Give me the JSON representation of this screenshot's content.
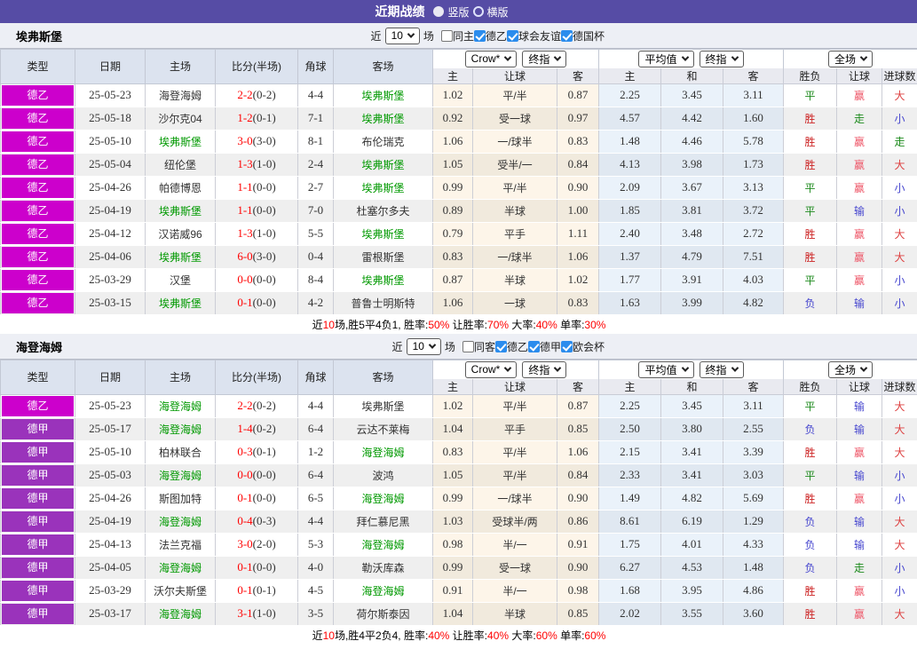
{
  "topbar": {
    "title": "近期战绩",
    "options": [
      {
        "label": "竖版",
        "selected": true
      },
      {
        "label": "横版",
        "selected": false
      }
    ]
  },
  "table_headers": {
    "left": [
      "类型",
      "日期",
      "主场",
      "比分(半场)",
      "角球",
      "客场"
    ],
    "asian": {
      "selects": [
        "Crow*",
        "终指"
      ],
      "cols": [
        "主",
        "让球",
        "客"
      ]
    },
    "euro": {
      "selects": [
        "平均值",
        "终指"
      ],
      "cols": [
        "主",
        "和",
        "客"
      ]
    },
    "result": {
      "selects": [
        "全场"
      ],
      "cols": [
        "胜负",
        "让球",
        "进球数"
      ]
    }
  },
  "filter": {
    "prefix": "近",
    "count": "10",
    "suffix": "场"
  },
  "league_colors": {
    "德乙": "#cc00cc",
    "德甲": "#9a33bb"
  },
  "result_colors": {
    "胜": "#cc2222",
    "平": "#1d8a1d",
    "负": "#4747cf",
    "赢": "#ee5567",
    "输": "#4747cf",
    "走": "#1d8a1d",
    "大": "#dd4040",
    "小": "#4747cf"
  },
  "teams": [
    {
      "name": "埃弗斯堡",
      "filters": [
        {
          "label": "同主",
          "checked": false
        },
        {
          "label": "德乙",
          "checked": true
        },
        {
          "label": "球会友谊",
          "checked": true
        },
        {
          "label": "德国杯",
          "checked": true
        }
      ],
      "rows": [
        {
          "lg": "德乙",
          "date": "25-05-23",
          "home": "海登海姆",
          "hs": false,
          "score": "2-2",
          "half": "(0-2)",
          "corner": "4-4",
          "away": "埃弗斯堡",
          "aws": true,
          "ah": [
            "1.02",
            "平/半",
            "0.87"
          ],
          "eu": [
            "2.25",
            "3.45",
            "3.11"
          ],
          "res": [
            "平",
            "赢",
            "大"
          ]
        },
        {
          "lg": "德乙",
          "date": "25-05-18",
          "home": "沙尔克04",
          "hs": false,
          "score": "1-2",
          "half": "(0-1)",
          "corner": "7-1",
          "away": "埃弗斯堡",
          "aws": true,
          "ah": [
            "0.92",
            "受一球",
            "0.97"
          ],
          "eu": [
            "4.57",
            "4.42",
            "1.60"
          ],
          "res": [
            "胜",
            "走",
            "小"
          ]
        },
        {
          "lg": "德乙",
          "date": "25-05-10",
          "home": "埃弗斯堡",
          "hs": true,
          "score": "3-0",
          "half": "(3-0)",
          "corner": "8-1",
          "away": "布伦瑞克",
          "aws": false,
          "ah": [
            "1.06",
            "一/球半",
            "0.83"
          ],
          "eu": [
            "1.48",
            "4.46",
            "5.78"
          ],
          "res": [
            "胜",
            "赢",
            "走"
          ]
        },
        {
          "lg": "德乙",
          "date": "25-05-04",
          "home": "纽伦堡",
          "hs": false,
          "score": "1-3",
          "half": "(1-0)",
          "corner": "2-4",
          "away": "埃弗斯堡",
          "aws": true,
          "ah": [
            "1.05",
            "受半/一",
            "0.84"
          ],
          "eu": [
            "4.13",
            "3.98",
            "1.73"
          ],
          "res": [
            "胜",
            "赢",
            "大"
          ]
        },
        {
          "lg": "德乙",
          "date": "25-04-26",
          "home": "帕德博恩",
          "hs": false,
          "score": "1-1",
          "half": "(0-0)",
          "corner": "2-7",
          "away": "埃弗斯堡",
          "aws": true,
          "ah": [
            "0.99",
            "平/半",
            "0.90"
          ],
          "eu": [
            "2.09",
            "3.67",
            "3.13"
          ],
          "res": [
            "平",
            "赢",
            "小"
          ]
        },
        {
          "lg": "德乙",
          "date": "25-04-19",
          "home": "埃弗斯堡",
          "hs": true,
          "score": "1-1",
          "half": "(0-0)",
          "corner": "7-0",
          "away": "杜塞尔多夫",
          "aws": false,
          "ah": [
            "0.89",
            "半球",
            "1.00"
          ],
          "eu": [
            "1.85",
            "3.81",
            "3.72"
          ],
          "res": [
            "平",
            "输",
            "小"
          ]
        },
        {
          "lg": "德乙",
          "date": "25-04-12",
          "home": "汉诺威96",
          "hs": false,
          "score": "1-3",
          "half": "(1-0)",
          "corner": "5-5",
          "away": "埃弗斯堡",
          "aws": true,
          "ah": [
            "0.79",
            "平手",
            "1.11"
          ],
          "eu": [
            "2.40",
            "3.48",
            "2.72"
          ],
          "res": [
            "胜",
            "赢",
            "大"
          ]
        },
        {
          "lg": "德乙",
          "date": "25-04-06",
          "home": "埃弗斯堡",
          "hs": true,
          "score": "6-0",
          "half": "(3-0)",
          "corner": "0-4",
          "away": "雷根斯堡",
          "aws": false,
          "ah": [
            "0.83",
            "一/球半",
            "1.06"
          ],
          "eu": [
            "1.37",
            "4.79",
            "7.51"
          ],
          "res": [
            "胜",
            "赢",
            "大"
          ]
        },
        {
          "lg": "德乙",
          "date": "25-03-29",
          "home": "汉堡",
          "hs": false,
          "score": "0-0",
          "half": "(0-0)",
          "corner": "8-4",
          "away": "埃弗斯堡",
          "aws": true,
          "ah": [
            "0.87",
            "半球",
            "1.02"
          ],
          "eu": [
            "1.77",
            "3.91",
            "4.03"
          ],
          "res": [
            "平",
            "赢",
            "小"
          ]
        },
        {
          "lg": "德乙",
          "date": "25-03-15",
          "home": "埃弗斯堡",
          "hs": true,
          "score": "0-1",
          "half": "(0-0)",
          "corner": "4-2",
          "away": "普鲁士明斯特",
          "aws": false,
          "ah": [
            "1.06",
            "一球",
            "0.83"
          ],
          "eu": [
            "1.63",
            "3.99",
            "4.82"
          ],
          "res": [
            "负",
            "输",
            "小"
          ]
        }
      ],
      "summary": [
        [
          "近",
          false
        ],
        [
          "10",
          true
        ],
        [
          "场,胜5平4负1, 胜率:",
          false
        ],
        [
          "50%",
          true
        ],
        [
          " 让胜率:",
          false
        ],
        [
          "70%",
          true
        ],
        [
          " 大率:",
          false
        ],
        [
          "40%",
          true
        ],
        [
          " 单率:",
          false
        ],
        [
          "30%",
          true
        ]
      ]
    },
    {
      "name": "海登海姆",
      "filters": [
        {
          "label": "同客",
          "checked": false
        },
        {
          "label": "德乙",
          "checked": true
        },
        {
          "label": "德甲",
          "checked": true
        },
        {
          "label": "欧会杯",
          "checked": true
        }
      ],
      "rows": [
        {
          "lg": "德乙",
          "date": "25-05-23",
          "home": "海登海姆",
          "hs": true,
          "score": "2-2",
          "half": "(0-2)",
          "corner": "4-4",
          "away": "埃弗斯堡",
          "aws": false,
          "ah": [
            "1.02",
            "平/半",
            "0.87"
          ],
          "eu": [
            "2.25",
            "3.45",
            "3.11"
          ],
          "res": [
            "平",
            "输",
            "大"
          ]
        },
        {
          "lg": "德甲",
          "date": "25-05-17",
          "home": "海登海姆",
          "hs": true,
          "score": "1-4",
          "half": "(0-2)",
          "corner": "6-4",
          "away": "云达不莱梅",
          "aws": false,
          "ah": [
            "1.04",
            "平手",
            "0.85"
          ],
          "eu": [
            "2.50",
            "3.80",
            "2.55"
          ],
          "res": [
            "负",
            "输",
            "大"
          ]
        },
        {
          "lg": "德甲",
          "date": "25-05-10",
          "home": "柏林联合",
          "hs": false,
          "score": "0-3",
          "half": "(0-1)",
          "corner": "1-2",
          "away": "海登海姆",
          "aws": true,
          "ah": [
            "0.83",
            "平/半",
            "1.06"
          ],
          "eu": [
            "2.15",
            "3.41",
            "3.39"
          ],
          "res": [
            "胜",
            "赢",
            "大"
          ]
        },
        {
          "lg": "德甲",
          "date": "25-05-03",
          "home": "海登海姆",
          "hs": true,
          "score": "0-0",
          "half": "(0-0)",
          "corner": "6-4",
          "away": "波鸿",
          "aws": false,
          "ah": [
            "1.05",
            "平/半",
            "0.84"
          ],
          "eu": [
            "2.33",
            "3.41",
            "3.03"
          ],
          "res": [
            "平",
            "输",
            "小"
          ]
        },
        {
          "lg": "德甲",
          "date": "25-04-26",
          "home": "斯图加特",
          "hs": false,
          "score": "0-1",
          "half": "(0-0)",
          "corner": "6-5",
          "away": "海登海姆",
          "aws": true,
          "ah": [
            "0.99",
            "一/球半",
            "0.90"
          ],
          "eu": [
            "1.49",
            "4.82",
            "5.69"
          ],
          "res": [
            "胜",
            "赢",
            "小"
          ]
        },
        {
          "lg": "德甲",
          "date": "25-04-19",
          "home": "海登海姆",
          "hs": true,
          "score": "0-4",
          "half": "(0-3)",
          "corner": "4-4",
          "away": "拜仁慕尼黑",
          "aws": false,
          "ah": [
            "1.03",
            "受球半/两",
            "0.86"
          ],
          "eu": [
            "8.61",
            "6.19",
            "1.29"
          ],
          "res": [
            "负",
            "输",
            "大"
          ]
        },
        {
          "lg": "德甲",
          "date": "25-04-13",
          "home": "法兰克福",
          "hs": false,
          "score": "3-0",
          "half": "(2-0)",
          "corner": "5-3",
          "away": "海登海姆",
          "aws": true,
          "ah": [
            "0.98",
            "半/一",
            "0.91"
          ],
          "eu": [
            "1.75",
            "4.01",
            "4.33"
          ],
          "res": [
            "负",
            "输",
            "大"
          ]
        },
        {
          "lg": "德甲",
          "date": "25-04-05",
          "home": "海登海姆",
          "hs": true,
          "score": "0-1",
          "half": "(0-0)",
          "corner": "4-0",
          "away": "勒沃库森",
          "aws": false,
          "ah": [
            "0.99",
            "受一球",
            "0.90"
          ],
          "eu": [
            "6.27",
            "4.53",
            "1.48"
          ],
          "res": [
            "负",
            "走",
            "小"
          ]
        },
        {
          "lg": "德甲",
          "date": "25-03-29",
          "home": "沃尔夫斯堡",
          "hs": false,
          "score": "0-1",
          "half": "(0-1)",
          "corner": "4-5",
          "away": "海登海姆",
          "aws": true,
          "ah": [
            "0.91",
            "半/一",
            "0.98"
          ],
          "eu": [
            "1.68",
            "3.95",
            "4.86"
          ],
          "res": [
            "胜",
            "赢",
            "小"
          ]
        },
        {
          "lg": "德甲",
          "date": "25-03-17",
          "home": "海登海姆",
          "hs": true,
          "score": "3-1",
          "half": "(1-0)",
          "corner": "3-5",
          "away": "荷尔斯泰因",
          "aws": false,
          "ah": [
            "1.04",
            "半球",
            "0.85"
          ],
          "eu": [
            "2.02",
            "3.55",
            "3.60"
          ],
          "res": [
            "胜",
            "赢",
            "大"
          ]
        }
      ],
      "summary": [
        [
          "近",
          false
        ],
        [
          "10",
          true
        ],
        [
          "场,胜4平2负4, 胜率:",
          false
        ],
        [
          "40%",
          true
        ],
        [
          " 让胜率:",
          false
        ],
        [
          "40%",
          true
        ],
        [
          " 大率:",
          false
        ],
        [
          "60%",
          true
        ],
        [
          " 单率:",
          false
        ],
        [
          "60%",
          true
        ]
      ]
    }
  ]
}
